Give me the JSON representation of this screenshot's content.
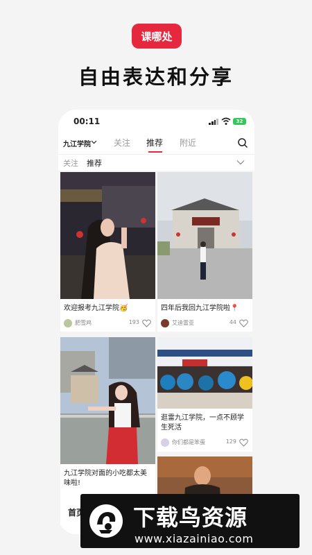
{
  "app_logo_text": "课哪处",
  "headline": "自由表达和分享",
  "status_bar": {
    "time": "00:11",
    "battery": "32"
  },
  "top_nav": {
    "school": "九江学院",
    "tabs": [
      "关注",
      "推荐",
      "附近"
    ],
    "active_tab": "推荐"
  },
  "sub_nav": {
    "items": [
      "关注",
      "推荐"
    ]
  },
  "feed": [
    {
      "title": "欢迎报考九江学院🥳",
      "author": "肥雪鸡",
      "likes": "193"
    },
    {
      "title": "四年后我回九江学院啦📍",
      "author": "艾迪雷亚",
      "likes": "44"
    },
    {
      "title": "九江学院对面的小吃都太美味啦!",
      "author": "",
      "likes": ""
    },
    {
      "title": "逛雷九江学院，一点不顾学生死活",
      "author": "你们都是笨蛋",
      "likes": "129"
    }
  ],
  "bottom_tab": "首页",
  "watermark": {
    "title": "下载鸟资源",
    "url": "www.xiazainiao.com"
  },
  "colors": {
    "accent": "#e6283f",
    "battery": "#34c759"
  }
}
